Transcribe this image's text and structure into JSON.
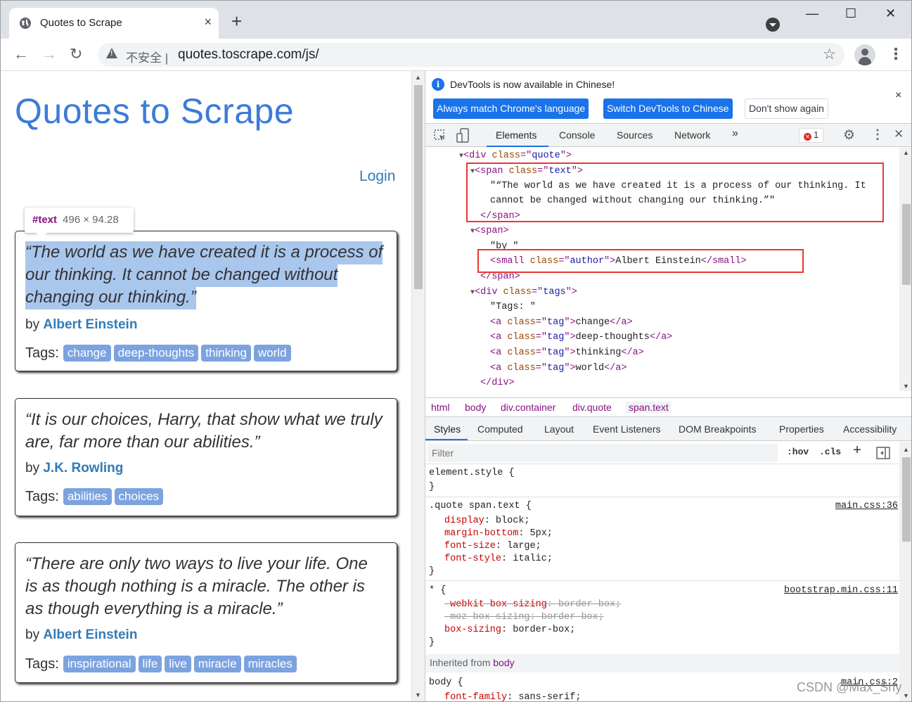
{
  "browser": {
    "tab_title": "Quotes to Scrape",
    "tab_close": "×",
    "new_tab": "+",
    "win_min": "—",
    "win_max": "☐",
    "win_close": "✕",
    "back": "←",
    "forward": "→",
    "reload": "↻",
    "insecure_label": "不安全",
    "url": "quotes.toscrape.com/js/",
    "star": "☆",
    "menu": "⋮"
  },
  "page": {
    "title": "Quotes to Scrape",
    "login": "Login",
    "inspect_tip": {
      "node": "#text",
      "size": "496 × 94.28"
    },
    "by": "by ",
    "tags_label": "Tags:",
    "quotes": [
      {
        "text": "“The world as we have created it is a process of our thinking. It cannot be changed without changing our thinking.”",
        "author": "Albert Einstein",
        "tags": [
          "change",
          "deep-thoughts",
          "thinking",
          "world"
        ]
      },
      {
        "text": "“It is our choices, Harry, that show what we truly are, far more than our abilities.”",
        "author": "J.K. Rowling",
        "tags": [
          "abilities",
          "choices"
        ]
      },
      {
        "text": "“There are only two ways to live your life. One is as though nothing is a miracle. The other is as though everything is a miracle.”",
        "author": "Albert Einstein",
        "tags": [
          "inspirational",
          "life",
          "live",
          "miracle",
          "miracles"
        ]
      }
    ]
  },
  "devtools": {
    "info_message": "DevTools is now available in Chinese!",
    "info_close": "×",
    "btn_match": "Always match Chrome's language",
    "btn_switch": "Switch DevTools to Chinese",
    "btn_dont": "Don't show again",
    "tabs": [
      "Elements",
      "Console",
      "Sources",
      "Network"
    ],
    "more_tabs": "»",
    "error_count": "1",
    "close": "✕",
    "dom": {
      "div_quote_class": "quote",
      "span_text_class": "text",
      "text_line1": "\"“The world as we have created it is a process of our thinking. It",
      "text_line2": "cannot be changed without changing our thinking.”\"",
      "by_text": "\"by \"",
      "small_class": "author",
      "author": "Albert Einstein",
      "tags_class": "tags",
      "tags_text": "\"Tags: \"",
      "tag_class": "tag",
      "tag_links": [
        "change",
        "deep-thoughts",
        "thinking",
        "world"
      ]
    },
    "breadcrumbs": [
      "html",
      "body",
      "div.container",
      "div.quote",
      "span.text"
    ],
    "sub_tabs": [
      "Styles",
      "Computed",
      "Layout",
      "Event Listeners",
      "DOM Breakpoints",
      "Properties",
      "Accessibility"
    ],
    "filter_placeholder": "Filter",
    "hov": ":hov",
    "cls": ".cls",
    "plus": "+",
    "styles": {
      "element_style": "element.style {",
      "close_brace": "}",
      "rule1_selector": ".quote span.text {",
      "rule1_source": "main.css:36",
      "rule1_props": [
        {
          "name": "display",
          "value": "block;"
        },
        {
          "name": "margin-bottom",
          "value": "5px;"
        },
        {
          "name": "font-size",
          "value": "large;"
        },
        {
          "name": "font-style",
          "value": "italic;"
        }
      ],
      "rule2_selector": "* {",
      "rule2_source": "bootstrap.min.css:11",
      "rule2_props": [
        {
          "name": "-webkit-box-sizing",
          "value": "border-box;"
        },
        {
          "name": "-moz-box-sizing",
          "value": "border-box;"
        },
        {
          "name": "box-sizing",
          "value": "border-box;"
        }
      ],
      "inherited_label": "Inherited from ",
      "inherited_from": "body",
      "rule3_selector": "body {",
      "rule3_source": "main.css:2",
      "rule3_prop": {
        "name": "font-family",
        "value": "sans-serif;"
      }
    }
  },
  "watermark": "CSDN @Max_Shy"
}
